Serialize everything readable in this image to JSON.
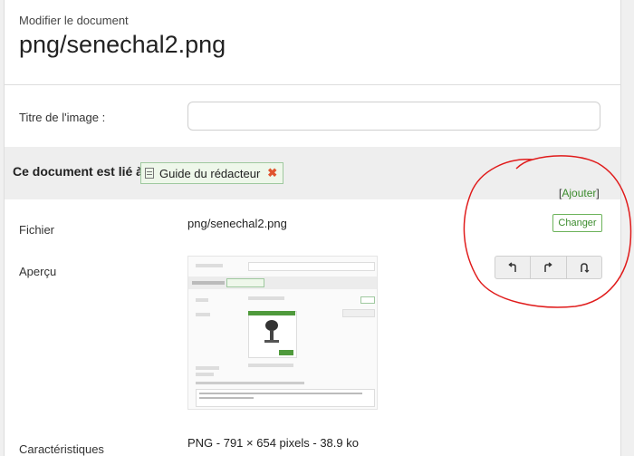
{
  "header": {
    "subtitle": "Modifier le document",
    "title": "png/senechal2.png"
  },
  "form": {
    "image_title_label": "Titre de l'image :",
    "image_title_value": "",
    "linked_label": "Ce document est lié à",
    "linked_tag": "Guide du rédacteur",
    "add_open": "[",
    "add_label": "Ajouter",
    "add_close": "]",
    "file_label": "Fichier",
    "file_value": "png/senechal2.png",
    "change_button": "Changer",
    "preview_label": "Aperçu",
    "characteristics_label": "Caractéristiques",
    "characteristics_value": "PNG - 791 × 654 pixels - 38.9 ko"
  },
  "colors": {
    "accent_green": "#3c8c2e",
    "remove_icon": "#e0552f",
    "annotation_red": "#e01b1b"
  }
}
